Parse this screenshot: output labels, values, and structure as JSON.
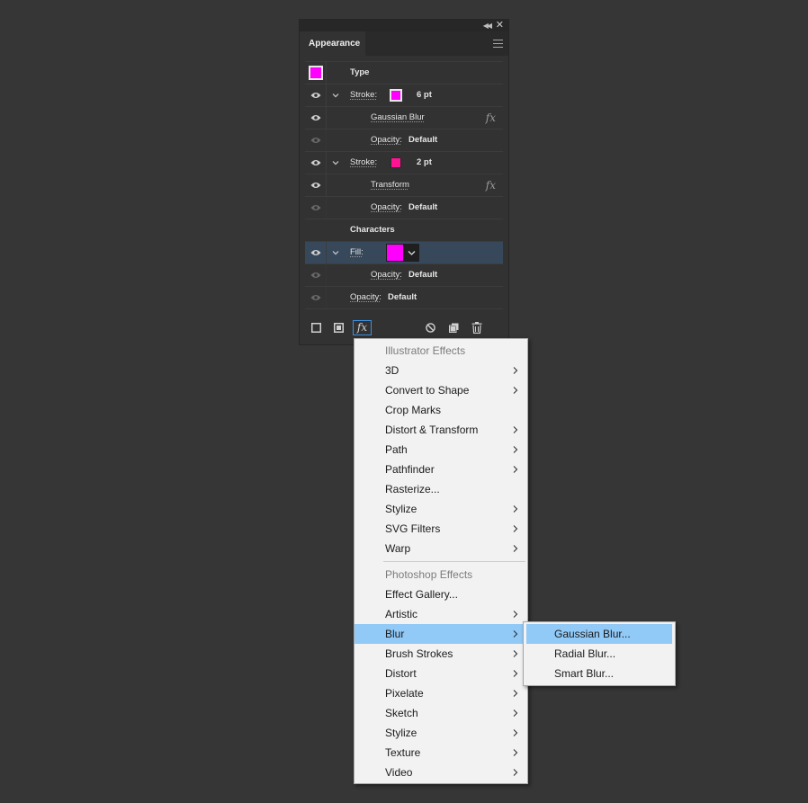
{
  "panel": {
    "tab_label": "Appearance",
    "rows": [
      {
        "id": "type",
        "label": "Type",
        "swatch_color": "#ff00ff"
      },
      {
        "id": "stroke1",
        "label": "Stroke:",
        "value": "6 pt",
        "swatch_color": "#ff00ff"
      },
      {
        "id": "gaussian",
        "label": "Gaussian Blur"
      },
      {
        "id": "opacity1",
        "label": "Opacity:",
        "value": "Default"
      },
      {
        "id": "stroke2",
        "label": "Stroke:",
        "value": "2 pt",
        "swatch_color": "#ff1493"
      },
      {
        "id": "transform",
        "label": "Transform"
      },
      {
        "id": "opacity2",
        "label": "Opacity:",
        "value": "Default"
      },
      {
        "id": "characters",
        "label": "Characters"
      },
      {
        "id": "fill",
        "label": "Fill:",
        "swatch_color": "#ff00ff"
      },
      {
        "id": "opacity3",
        "label": "Opacity:",
        "value": "Default"
      },
      {
        "id": "opacity4",
        "label": "Opacity:",
        "value": "Default"
      }
    ],
    "fx_label": "fx"
  },
  "effects_menu": {
    "illustrator_header": "Illustrator Effects",
    "illustrator_items": [
      {
        "label": "3D",
        "submenu": true
      },
      {
        "label": "Convert to Shape",
        "submenu": true
      },
      {
        "label": "Crop Marks",
        "submenu": false
      },
      {
        "label": "Distort & Transform",
        "submenu": true
      },
      {
        "label": "Path",
        "submenu": true
      },
      {
        "label": "Pathfinder",
        "submenu": true
      },
      {
        "label": "Rasterize...",
        "submenu": false
      },
      {
        "label": "Stylize",
        "submenu": true
      },
      {
        "label": "SVG Filters",
        "submenu": true
      },
      {
        "label": "Warp",
        "submenu": true
      }
    ],
    "photoshop_header": "Photoshop Effects",
    "photoshop_items": [
      {
        "label": "Effect Gallery...",
        "submenu": false
      },
      {
        "label": "Artistic",
        "submenu": true
      },
      {
        "label": "Blur",
        "submenu": true,
        "highlighted": true
      },
      {
        "label": "Brush Strokes",
        "submenu": true
      },
      {
        "label": "Distort",
        "submenu": true
      },
      {
        "label": "Pixelate",
        "submenu": true
      },
      {
        "label": "Sketch",
        "submenu": true
      },
      {
        "label": "Stylize",
        "submenu": true
      },
      {
        "label": "Texture",
        "submenu": true
      },
      {
        "label": "Video",
        "submenu": true
      }
    ]
  },
  "blur_submenu": {
    "items": [
      {
        "label": "Gaussian Blur...",
        "highlighted": true
      },
      {
        "label": "Radial Blur..."
      },
      {
        "label": "Smart Blur..."
      }
    ]
  },
  "colors": {
    "highlight": "#91c9f7",
    "selected_row": "#37485a",
    "focus_ring": "#3d8fe0"
  }
}
